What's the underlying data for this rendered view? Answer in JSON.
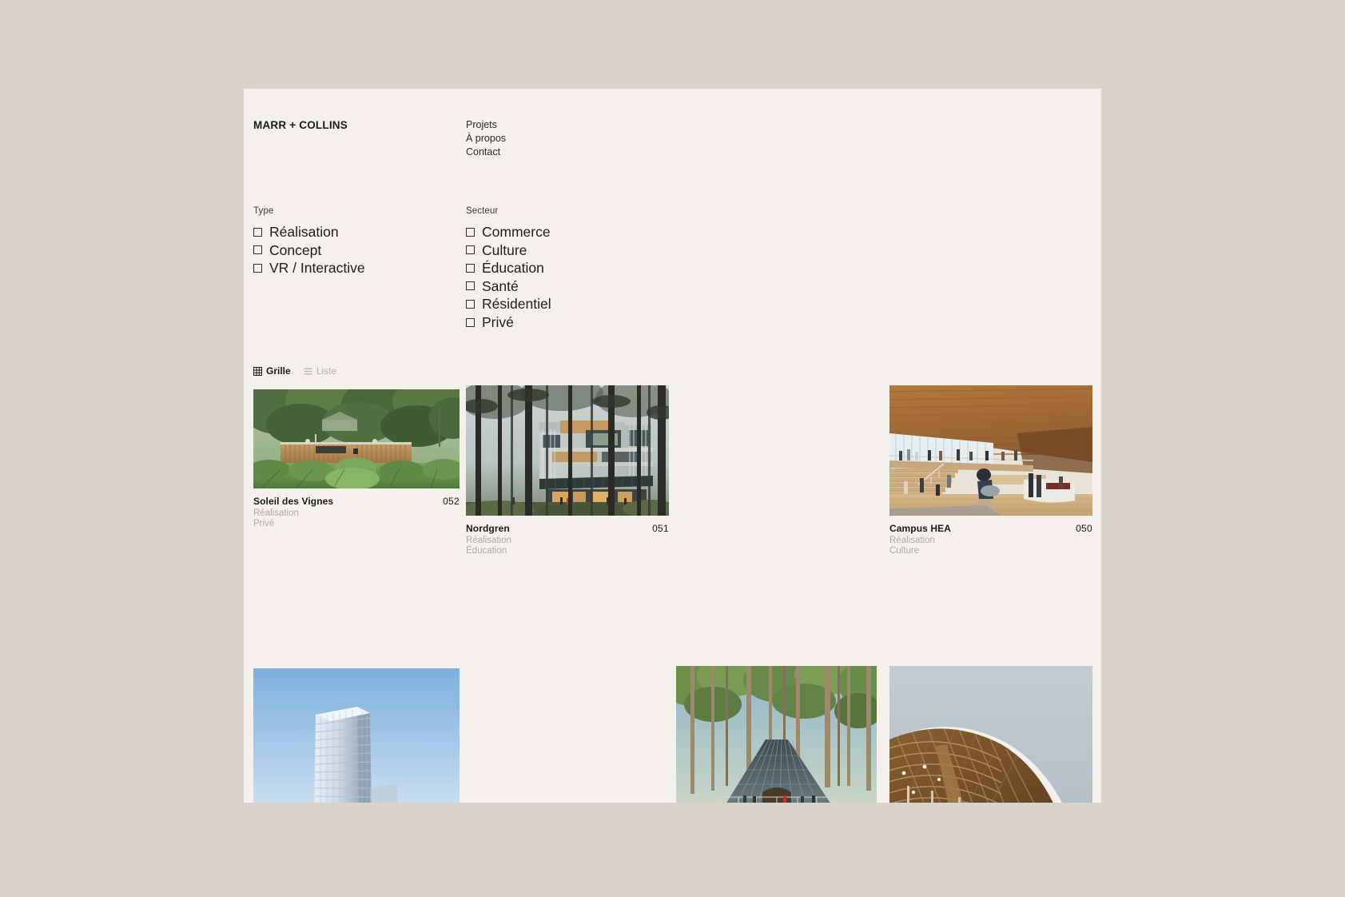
{
  "site": {
    "masthead": "MARR + COLLINS",
    "background_outer": "#d9d3ce",
    "background_page": "#f4f0ec",
    "accent_muted": "#b0aaa4"
  },
  "nav": {
    "items": [
      {
        "label": "Projets"
      },
      {
        "label": "À propos"
      },
      {
        "label": "Contact"
      }
    ]
  },
  "filters": {
    "type": {
      "heading": "Type",
      "options": [
        {
          "label": "Réalisation",
          "checked": false
        },
        {
          "label": "Concept",
          "checked": false
        },
        {
          "label": "VR / Interactive",
          "checked": false
        }
      ]
    },
    "sector": {
      "heading": "Secteur",
      "options": [
        {
          "label": "Commerce",
          "checked": false
        },
        {
          "label": "Culture",
          "checked": false
        },
        {
          "label": "Éducation",
          "checked": false
        },
        {
          "label": "Santé",
          "checked": false
        },
        {
          "label": "Résidentiel",
          "checked": false
        },
        {
          "label": "Privé",
          "checked": false
        }
      ]
    }
  },
  "view_toggle": {
    "grid": {
      "label": "Grille",
      "icon": "grid-icon",
      "active": true
    },
    "list": {
      "label": "Liste",
      "icon": "list-icon",
      "active": false
    }
  },
  "projects": [
    {
      "title": "Soleil des Vignes",
      "number": "052",
      "tags": [
        "Réalisation",
        "Privé"
      ],
      "image": "vineyard-timber-pavilion"
    },
    {
      "title": "Nordgren",
      "number": "051",
      "tags": [
        "Réalisation",
        "Éducation"
      ],
      "image": "forest-school-building"
    },
    {
      "title": "Campus HEA",
      "number": "050",
      "tags": [
        "Réalisation",
        "Culture"
      ],
      "image": "timber-atrium-interior"
    },
    {
      "title": "",
      "number": "",
      "tags": [],
      "image": "white-tower-blue-sky"
    },
    {
      "title": "",
      "number": "",
      "tags": [],
      "image": "forest-amphitheatre"
    },
    {
      "title": "",
      "number": "",
      "tags": [],
      "image": "timber-lattice-canopy"
    }
  ]
}
